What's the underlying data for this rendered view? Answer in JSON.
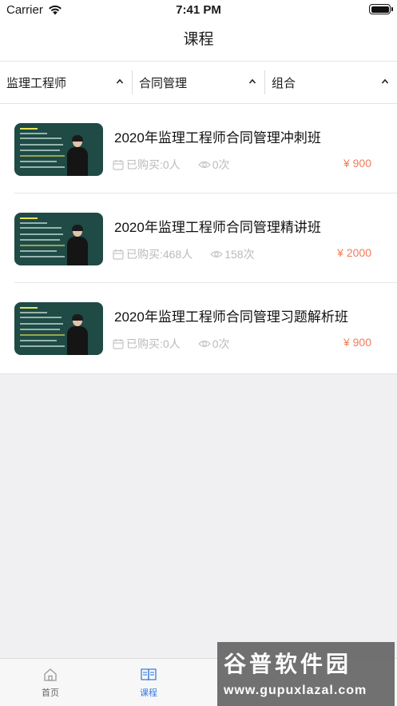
{
  "status_bar": {
    "carrier": "Carrier",
    "time": "7:41 PM"
  },
  "nav": {
    "title": "课程"
  },
  "filters": [
    {
      "label": "监理工程师"
    },
    {
      "label": "合同管理"
    },
    {
      "label": "组合"
    }
  ],
  "courses": [
    {
      "title": "2020年监理工程师合同管理冲刺班",
      "purchased": "已购买:0人",
      "views": "0次",
      "price": "¥ 900"
    },
    {
      "title": "2020年监理工程师合同管理精讲班",
      "purchased": "已购买:468人",
      "views": "158次",
      "price": "¥ 2000"
    },
    {
      "title": "2020年监理工程师合同管理习题解析班",
      "purchased": "已购买:0人",
      "views": "0次",
      "price": "¥ 900"
    }
  ],
  "tabs": [
    {
      "label": "首页",
      "icon": "home-icon",
      "active": false
    },
    {
      "label": "课程",
      "icon": "book-icon",
      "active": true
    }
  ],
  "watermark": {
    "text": "谷普软件园",
    "url": "www.gupuxlazal.com"
  },
  "colors": {
    "accent": "#3a7dde",
    "price": "#f07b5a",
    "muted": "#bbbbbb"
  }
}
